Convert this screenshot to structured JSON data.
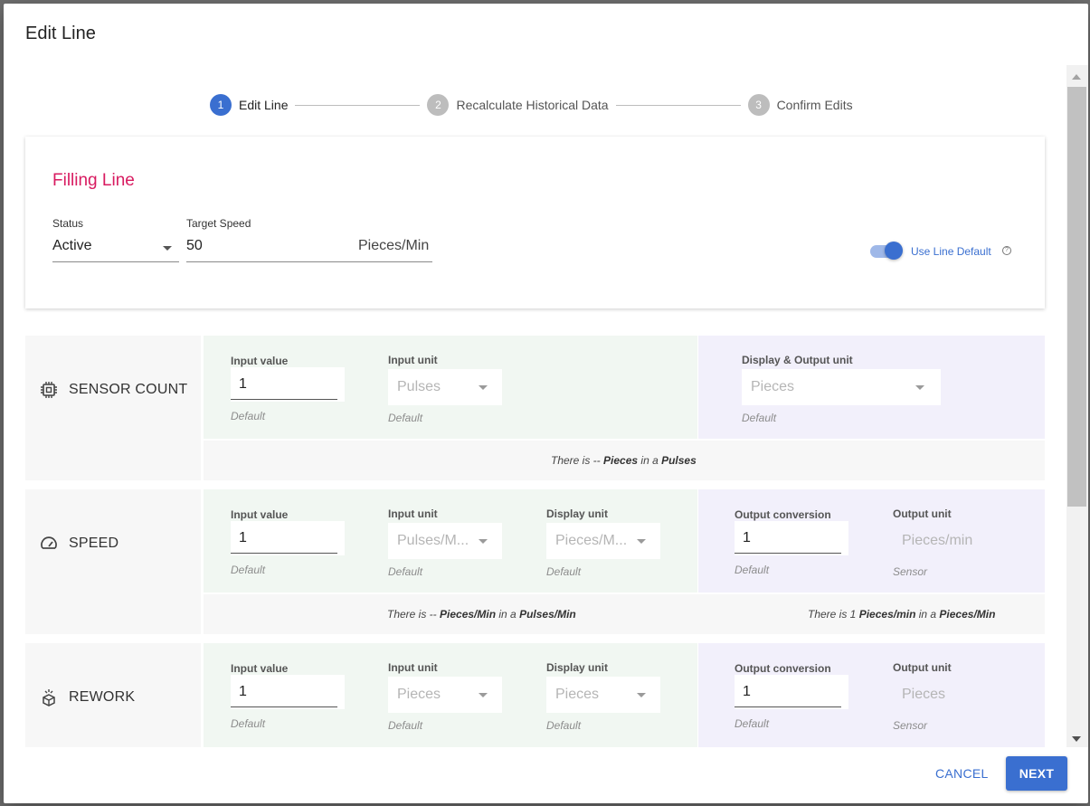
{
  "dialog": {
    "title": "Edit Line"
  },
  "stepper": [
    {
      "number": "1",
      "label": "Edit Line",
      "state": "active"
    },
    {
      "number": "2",
      "label": "Recalculate Historical Data",
      "state": "inactive"
    },
    {
      "number": "3",
      "label": "Confirm Edits",
      "state": "inactive"
    }
  ],
  "line": {
    "name": "Filling Line",
    "status_label": "Status",
    "status_value": "Active",
    "target_label": "Target Speed",
    "target_value": "50",
    "target_unit": "Pieces/Min",
    "toggle_label": "Use Line Default",
    "toggle_on": true,
    "help_glyph": "?"
  },
  "metrics": {
    "sensor": {
      "name": "SENSOR COUNT",
      "icon": "chip-icon",
      "input_value_label": "Input value",
      "input_value": "1",
      "input_value_hint": "Default",
      "input_unit_label": "Input unit",
      "input_unit": "Pulses",
      "input_unit_hint": "Default",
      "output_label": "Display & Output unit",
      "output_unit": "Pieces",
      "output_hint": "Default",
      "note_prefix": "There is -- ",
      "note_a": "Pieces",
      "note_mid": " in a ",
      "note_b": "Pulses"
    },
    "speed": {
      "name": "SPEED",
      "icon": "speedometer-icon",
      "input_value_label": "Input value",
      "input_value": "1",
      "input_value_hint": "Default",
      "input_unit_label": "Input unit",
      "input_unit": "Pulses/M...",
      "input_unit_hint": "Default",
      "display_unit_label": "Display unit",
      "display_unit": "Pieces/M...",
      "display_unit_hint": "Default",
      "conversion_label": "Output conversion",
      "conversion_value": "1",
      "conversion_hint": "Default",
      "output_unit_label": "Output unit",
      "output_unit": "Pieces/min",
      "output_unit_hint": "Sensor",
      "note1_prefix": "There is -- ",
      "note1_a": "Pieces/Min",
      "note1_mid": " in a ",
      "note1_b": "Pulses/Min",
      "note2_prefix": "There is 1 ",
      "note2_a": "Pieces/min",
      "note2_mid": " in a ",
      "note2_b": "Pieces/Min"
    },
    "rework": {
      "name": "REWORK",
      "icon": "rework-box-icon",
      "input_value_label": "Input value",
      "input_value": "1",
      "input_value_hint": "Default",
      "input_unit_label": "Input unit",
      "input_unit": "Pieces",
      "input_unit_hint": "Default",
      "display_unit_label": "Display unit",
      "display_unit": "Pieces",
      "display_unit_hint": "Default",
      "conversion_label": "Output conversion",
      "conversion_value": "1",
      "conversion_hint": "Default",
      "output_unit_label": "Output unit",
      "output_unit": "Pieces",
      "output_unit_hint": "Sensor"
    }
  },
  "footer": {
    "cancel_label": "CANCEL",
    "next_label": "NEXT"
  },
  "colors": {
    "primary": "#3a6fd0",
    "line_name": "#d81b60",
    "green_panel": "#f1f7f2",
    "purple_panel": "#f2f0fb"
  }
}
